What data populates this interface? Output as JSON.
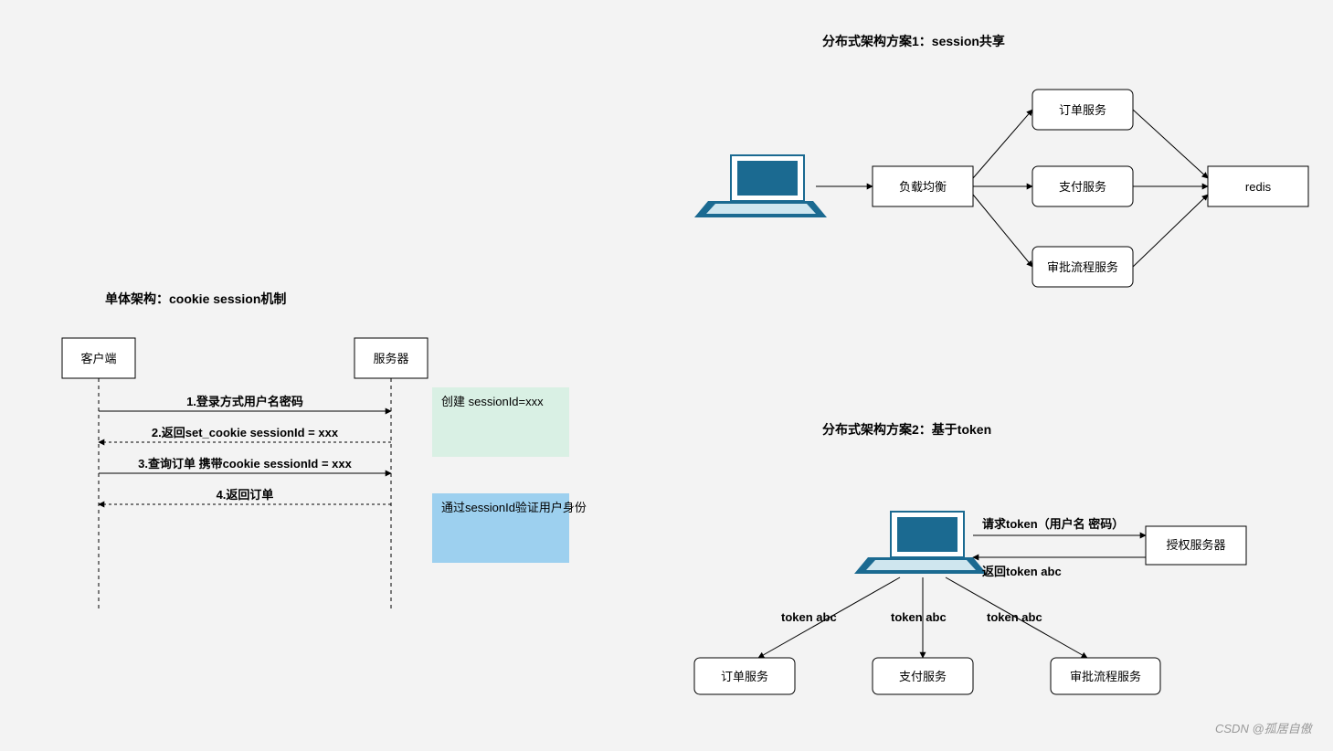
{
  "watermark": "CSDN @孤居自傲",
  "monolith": {
    "title": "单体架构：cookie session机制",
    "client": "客户端",
    "server": "服务器",
    "messages": {
      "m1": "1.登录方式用户名密码",
      "m2": "2.返回set_cookie sessionId = xxx",
      "m3": "3.查询订单 携带cookie sessionId = xxx",
      "m4": "4.返回订单"
    },
    "note1": "创建 sessionId=xxx",
    "note2": "通过sessionId验证用户身份"
  },
  "dist1": {
    "title": "分布式架构方案1：session共享",
    "lb": "负载均衡",
    "svc_order": "订单服务",
    "svc_pay": "支付服务",
    "svc_approve": "审批流程服务",
    "redis": "redis"
  },
  "dist2": {
    "title": "分布式架构方案2：基于token",
    "auth_server": "授权服务器",
    "req_token": "请求token（用户名 密码）",
    "ret_token": "返回token abc",
    "token_label": "token abc",
    "svc_order": "订单服务",
    "svc_pay": "支付服务",
    "svc_approve": "审批流程服务"
  }
}
